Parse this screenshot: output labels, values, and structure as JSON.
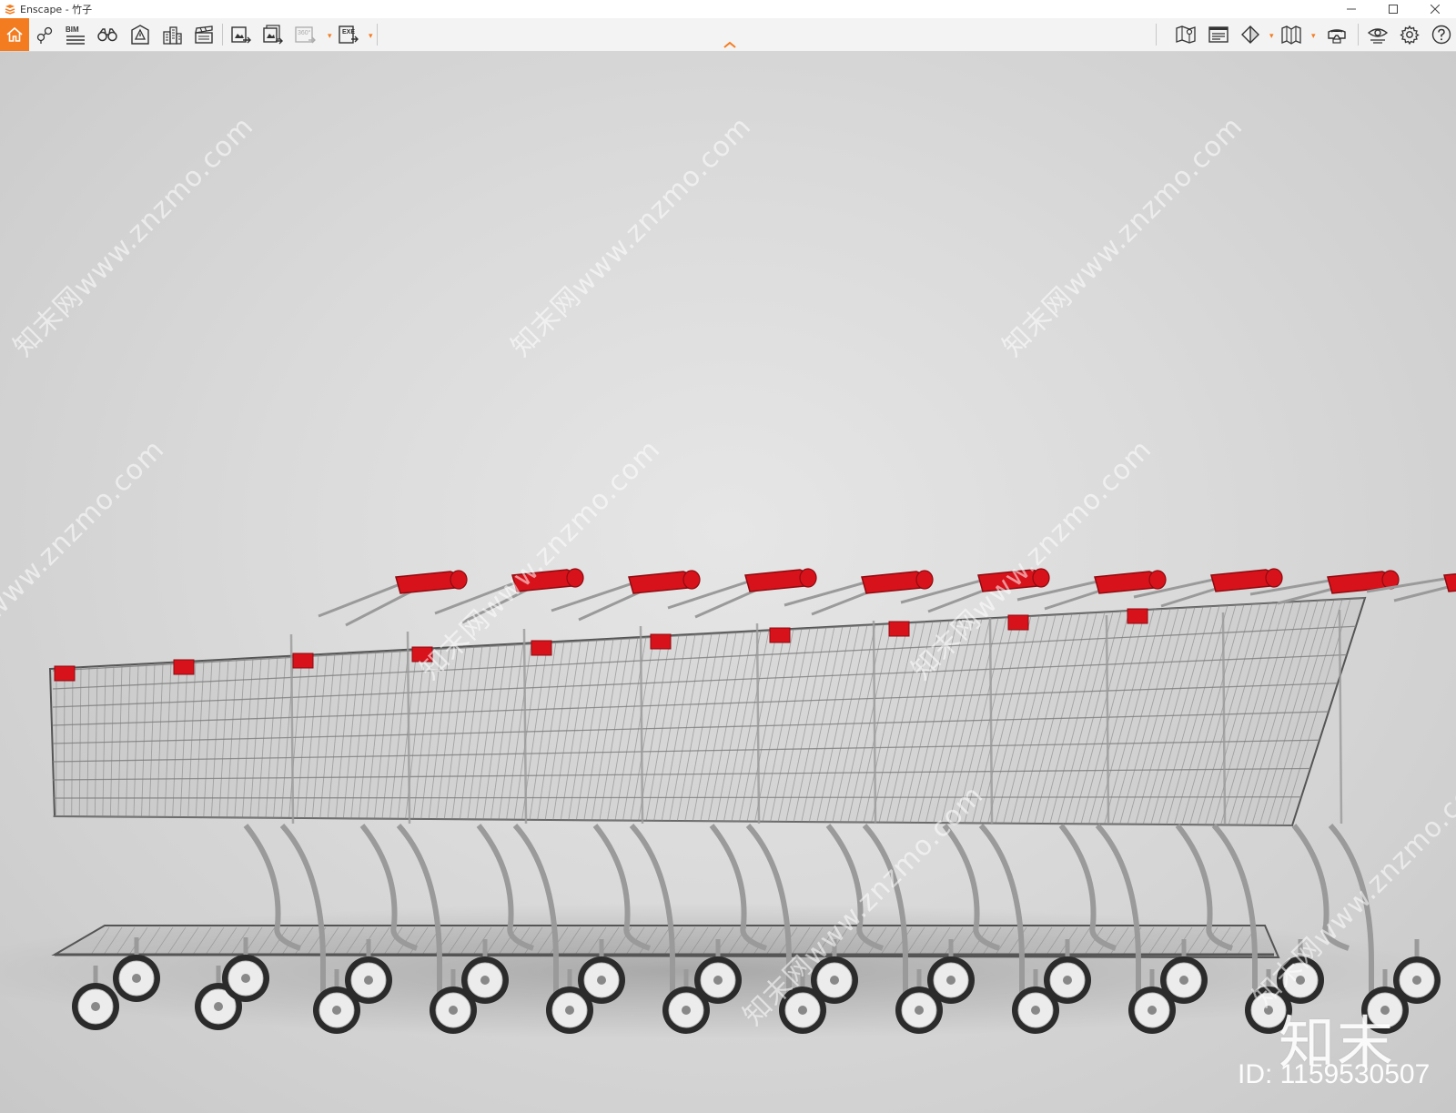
{
  "window": {
    "title": "Enscape - 竹子",
    "controls": [
      "minimize-icon",
      "maximize-icon",
      "close-icon"
    ]
  },
  "toolbar": {
    "bim_label": "BIM",
    "batch_360_label": "360°",
    "exe_label": "EXE",
    "accent_color": "#f47c20",
    "left_icons": [
      "home-icon",
      "location-pin-icon",
      "bim-list-icon",
      "binoculars-icon",
      "building-warning-icon",
      "city-buildings-icon",
      "clapperboard-icon",
      "render-export-icon",
      "batch-render-icon",
      "panorama-360-icon",
      "exe-export-icon"
    ],
    "right_icons": [
      "map-icon",
      "screen-text-icon",
      "half-circle-icon",
      "book-icon",
      "vr-headset-icon",
      "eye-icon",
      "gear-icon",
      "help-icon"
    ]
  },
  "viewport": {
    "watermark_text": "知末网www.znzmo.com",
    "corner_logo": "知末",
    "corner_id": "ID: 1159530507",
    "background_color": "#d9d9d9",
    "accent_handle_color": "#d8121b"
  }
}
